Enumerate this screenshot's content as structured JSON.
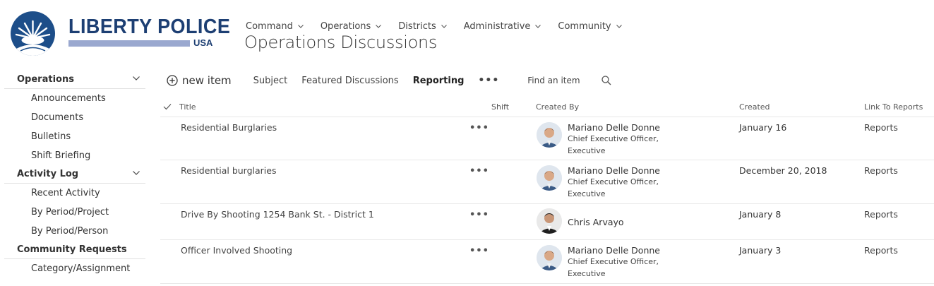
{
  "brand": {
    "name": "LIBERTY POLICE",
    "sub": "USA"
  },
  "topnav": [
    {
      "label": "Command"
    },
    {
      "label": "Operations"
    },
    {
      "label": "Districts"
    },
    {
      "label": "Administrative"
    },
    {
      "label": "Community"
    }
  ],
  "page_title": "Operations Discussions",
  "leftnav": {
    "sections": [
      {
        "label": "Operations",
        "links": [
          "Announcements",
          "Documents",
          "Bulletins",
          "Shift Briefing"
        ]
      },
      {
        "label": "Activity Log",
        "links": [
          "Recent Activity",
          "By Period/Project",
          "By Period/Person"
        ]
      },
      {
        "label": "Community Requests",
        "links": [
          "Category/Assignment"
        ]
      }
    ]
  },
  "cmdbar": {
    "new_item": "new item",
    "views": [
      "Subject",
      "Featured Discussions",
      "Reporting"
    ],
    "active_view": "Reporting",
    "search_placeholder": "Find an item"
  },
  "columns": {
    "title": "Title",
    "shift": "Shift",
    "created_by": "Created By",
    "created": "Created",
    "link": "Link To Reports"
  },
  "rows": [
    {
      "title": "Residential Burglaries",
      "name": "Mariano Delle Donne",
      "job": "Chief Executive Officer, Executive",
      "created": "January 16",
      "link": "Reports"
    },
    {
      "title": "Residential burglaries",
      "name": "Mariano Delle Donne",
      "job": "Chief Executive Officer, Executive",
      "created": "December 20, 2018",
      "link": "Reports"
    },
    {
      "title": "Drive By Shooting 1254 Bank St. - District 1",
      "name": "Chris Arvayo",
      "job": "",
      "created": "January 8",
      "link": "Reports"
    },
    {
      "title": "Officer Involved Shooting",
      "name": "Mariano Delle Donne",
      "job": "Chief Executive Officer, Executive",
      "created": "January 3",
      "link": "Reports"
    }
  ],
  "colors": {
    "brand_navy": "#1d3f73",
    "badge_blue": "#1d4e89",
    "brand_bar": "#9aa8cf"
  }
}
